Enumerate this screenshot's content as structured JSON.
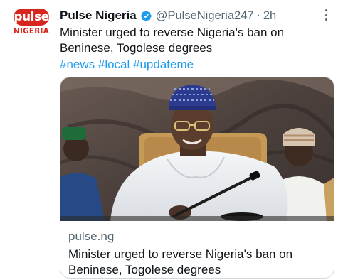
{
  "author": {
    "display_name": "Pulse Nigeria",
    "handle": "@PulseNigeria247",
    "separator": "·",
    "time": "2h",
    "avatar": {
      "wordmark": "pulse",
      "subtitle": "NIGERIA",
      "brand_color": "#d7261e"
    }
  },
  "verified_badge": {
    "icon": "verified-badge-icon",
    "color": "#1d9bf0"
  },
  "tweet": {
    "text": "Minister urged to reverse Nigeria's ban on Beninese, Togolese degrees",
    "hashtags": [
      "#news",
      "#local",
      "#updateme"
    ]
  },
  "card": {
    "image": "photo-of-minister-smiling-at-microphone",
    "domain": "pulse.ng",
    "title": "Minister urged to reverse Nigeria's ban on Beninese, Togolese degrees"
  },
  "more_menu_icon": "more-options-icon",
  "colors": {
    "text": "#0f1419",
    "secondary": "#536471",
    "link": "#1d9bf0",
    "border": "#cfd9de"
  }
}
